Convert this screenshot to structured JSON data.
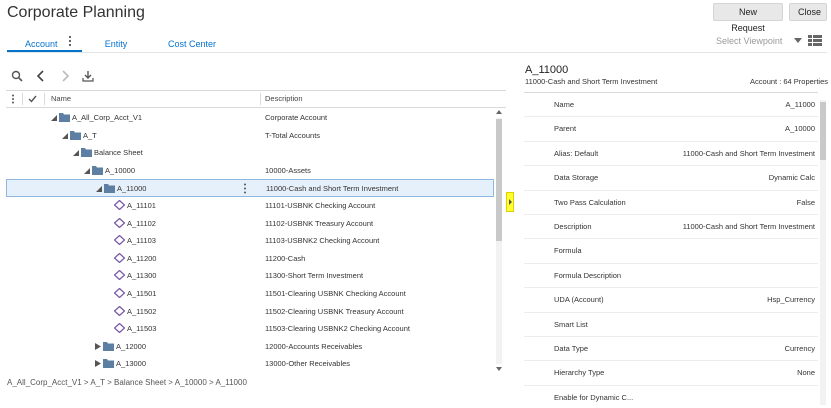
{
  "app": {
    "title": "Corporate Planning"
  },
  "header_buttons": {
    "new_request": "New Request",
    "close": "Close"
  },
  "tabs": [
    {
      "label": "Account",
      "active": true
    },
    {
      "label": "Entity",
      "active": false
    },
    {
      "label": "Cost Center",
      "active": false
    }
  ],
  "viewpoint": {
    "placeholder": "Select Viewpoint"
  },
  "toolbar": {
    "icons": [
      "search-icon",
      "chevron-left-icon",
      "chevron-right-icon",
      "download-icon"
    ]
  },
  "grid": {
    "columns": {
      "name": "Name",
      "description": "Description"
    },
    "rows": [
      {
        "name": "A_All_Corp_Acct_V1",
        "description": "Corporate Account",
        "level": 0,
        "kind": "folder",
        "expanded": true
      },
      {
        "name": "A_T",
        "description": "T-Total Accounts",
        "level": 1,
        "kind": "folder",
        "expanded": true
      },
      {
        "name": "Balance Sheet",
        "description": "",
        "level": 2,
        "kind": "folder",
        "expanded": true
      },
      {
        "name": "A_10000",
        "description": "10000-Assets",
        "level": 3,
        "kind": "folder",
        "expanded": true
      },
      {
        "name": "A_11000",
        "description": "11000-Cash and Short Term Investment",
        "level": 4,
        "kind": "folder",
        "expanded": true,
        "selected": true
      },
      {
        "name": "A_11101",
        "description": "11101-USBNK Checking Account",
        "level": 5,
        "kind": "leaf"
      },
      {
        "name": "A_11102",
        "description": "11102-USBNK Treasury Account",
        "level": 5,
        "kind": "leaf"
      },
      {
        "name": "A_11103",
        "description": "11103-USBNK2 Checking Account",
        "level": 5,
        "kind": "leaf"
      },
      {
        "name": "A_11200",
        "description": "11200-Cash",
        "level": 5,
        "kind": "leaf"
      },
      {
        "name": "A_11300",
        "description": "11300-Short Term Investment",
        "level": 5,
        "kind": "leaf"
      },
      {
        "name": "A_11501",
        "description": "11501-Clearing USBNK Checking Account",
        "level": 5,
        "kind": "leaf"
      },
      {
        "name": "A_11502",
        "description": "11502-Clearing USBNK Treasury Account",
        "level": 5,
        "kind": "leaf"
      },
      {
        "name": "A_11503",
        "description": "11503-Clearing USBNK2 Checking Account",
        "level": 5,
        "kind": "leaf"
      },
      {
        "name": "A_12000",
        "description": "12000-Accounts Receivables",
        "level": 4,
        "kind": "folder",
        "expanded": false
      },
      {
        "name": "A_13000",
        "description": "13000-Other Receivables",
        "level": 4,
        "kind": "folder",
        "expanded": false
      }
    ]
  },
  "breadcrumb": {
    "path": "A_All_Corp_Acct_V1  >  A_T  >  Balance Sheet  >  A_10000  >  A_11000"
  },
  "properties_panel": {
    "title": "A_11000",
    "subtitle": "11000-Cash and Short Term Investment",
    "count": "Account : 64 Properties",
    "properties": [
      {
        "name": "Name",
        "value": "A_11000"
      },
      {
        "name": "Parent",
        "value": "A_10000"
      },
      {
        "name": "Alias: Default",
        "value": "11000-Cash and Short Term Investment"
      },
      {
        "name": "Data Storage",
        "value": "Dynamic Calc"
      },
      {
        "name": "Two Pass Calculation",
        "value": "False"
      },
      {
        "name": "Description",
        "value": "11000-Cash and Short Term Investment"
      },
      {
        "name": "Formula",
        "value": ""
      },
      {
        "name": "Formula Description",
        "value": ""
      },
      {
        "name": "UDA (Account)",
        "value": "Hsp_Currency"
      },
      {
        "name": "Smart List",
        "value": ""
      },
      {
        "name": "Data Type",
        "value": "Currency"
      },
      {
        "name": "Hierarchy Type",
        "value": "None"
      },
      {
        "name": "Enable for Dynamic C...",
        "value": ""
      }
    ]
  },
  "colors": {
    "accent": "#0572ce",
    "folder": "#5d7fa3",
    "leaf": "#7a5aa8",
    "splitter": "#ffff33"
  }
}
